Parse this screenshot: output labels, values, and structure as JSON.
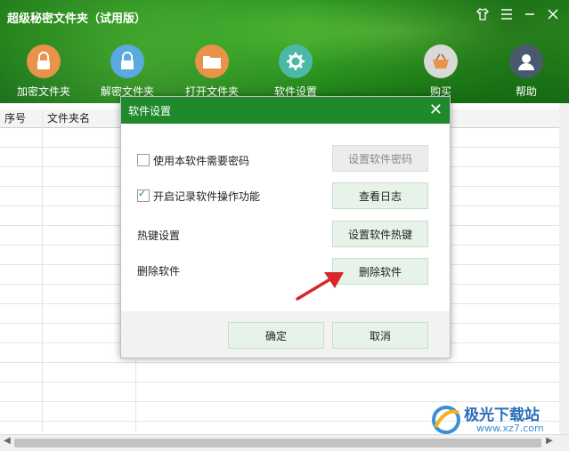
{
  "app": {
    "title": "超级秘密文件夹（试用版）"
  },
  "toolbar": {
    "items": [
      {
        "label": "加密文件夹",
        "icon": "lock-icon",
        "color": "#e8924a"
      },
      {
        "label": "解密文件夹",
        "icon": "unlock-icon",
        "color": "#5aa9df"
      },
      {
        "label": "打开文件夹",
        "icon": "folder-icon",
        "color": "#e8924a"
      },
      {
        "label": "软件设置",
        "icon": "gear-icon",
        "color": "#4cb8a8"
      },
      {
        "label": "购买",
        "icon": "basket-icon",
        "color": "#d9d9d9"
      },
      {
        "label": "帮助",
        "icon": "user-icon",
        "color": "#4a5a6e"
      }
    ]
  },
  "grid": {
    "columns": [
      "序号",
      "文件夹名"
    ]
  },
  "dialog": {
    "title": "软件设置",
    "require_password": {
      "label": "使用本软件需要密码",
      "checked": false,
      "button": "设置软件密码"
    },
    "log": {
      "label": "开启记录软件操作功能",
      "checked": true,
      "button": "查看日志"
    },
    "hotkey": {
      "label": "热键设置",
      "button": "设置软件热键"
    },
    "uninstall": {
      "label": "删除软件",
      "button": "删除软件"
    },
    "ok": "确定",
    "cancel": "取消"
  },
  "watermark": {
    "name": "极光下载站",
    "url": "www.xz7.com"
  },
  "colors": {
    "accent": "#1f8a2c",
    "arrow": "#d9262b"
  }
}
